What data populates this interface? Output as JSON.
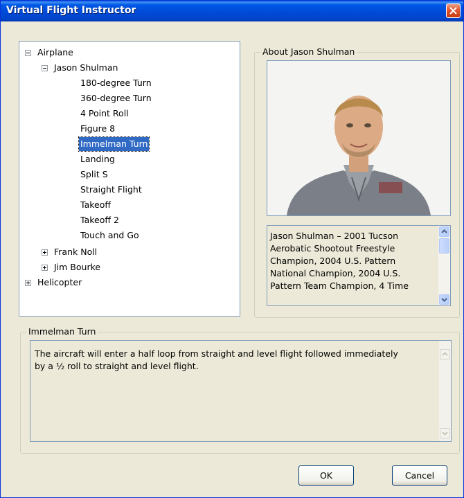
{
  "window": {
    "title": "Virtual Flight Instructor"
  },
  "tree": {
    "root_airplane": "Airplane",
    "instructor_jason": "Jason Shulman",
    "maneuvers": [
      "180-degree Turn",
      "360-degree Turn",
      "4 Point Roll",
      "Figure 8",
      "Immelman Turn",
      "Landing",
      "Split S",
      "Straight Flight",
      "Takeoff",
      "Takeoff 2",
      "Touch and Go"
    ],
    "selected_maneuver": "Immelman Turn",
    "instructor_frank": "Frank Noll",
    "instructor_jim": "Jim Bourke",
    "root_helicopter": "Helicopter"
  },
  "about": {
    "legend": "About Jason Shulman",
    "bio_lines": [
      "Jason Shulman – 2001 Tucson",
      "Aerobatic Shootout Freestyle",
      "Champion, 2004 U.S. Pattern",
      "National Champion, 2004 U.S.",
      "Pattern Team Champion, 4 Time"
    ]
  },
  "description": {
    "legend": "Immelman Turn",
    "line1": "The aircraft will enter a half loop from straight and level flight followed immediately",
    "line2": "by a ½ roll to straight and level flight."
  },
  "buttons": {
    "ok": "OK",
    "cancel": "Cancel"
  },
  "colors": {
    "selection": "#316ac5",
    "dialog_bg": "#ece9d8",
    "titlebar": "#0049d6"
  }
}
